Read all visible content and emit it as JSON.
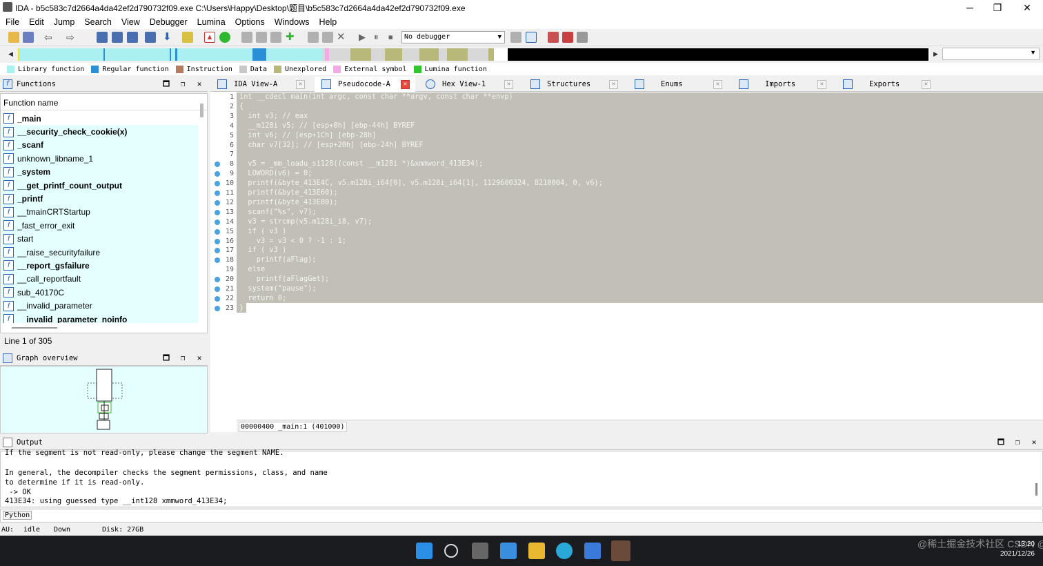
{
  "window": {
    "title": "IDA - b5c583c7d2664a4da42ef2d790732f09.exe C:\\Users\\Happy\\Desktop\\题目\\b5c583c7d2664a4da42ef2d790732f09.exe",
    "min": "─",
    "max": "❐",
    "close": "✕"
  },
  "menu": [
    "File",
    "Edit",
    "Jump",
    "Search",
    "View",
    "Debugger",
    "Lumina",
    "Options",
    "Windows",
    "Help"
  ],
  "toolbar": {
    "debugger": "No debugger"
  },
  "legend": [
    {
      "label": "Library function",
      "color": "#aaf0f0"
    },
    {
      "label": "Regular function",
      "color": "#2b8fd8"
    },
    {
      "label": "Instruction",
      "color": "#b87a5c"
    },
    {
      "label": "Data",
      "color": "#c8c8c8"
    },
    {
      "label": "Unexplored",
      "color": "#b8b878"
    },
    {
      "label": "External symbol",
      "color": "#f4a8e8"
    },
    {
      "label": "Lumina function",
      "color": "#2ec82e"
    }
  ],
  "functions_panel": {
    "title": "Functions",
    "column": "Function name",
    "items": [
      {
        "name": "_main",
        "bold": true
      },
      {
        "name": "__security_check_cookie(x)",
        "bold": true
      },
      {
        "name": "_scanf",
        "bold": true
      },
      {
        "name": "unknown_libname_1",
        "bold": false
      },
      {
        "name": "_system",
        "bold": true
      },
      {
        "name": "__get_printf_count_output",
        "bold": true
      },
      {
        "name": "_printf",
        "bold": true
      },
      {
        "name": "__tmainCRTStartup",
        "bold": false
      },
      {
        "name": "_fast_error_exit",
        "bold": false
      },
      {
        "name": "start",
        "bold": false
      },
      {
        "name": "__raise_securityfailure",
        "bold": false
      },
      {
        "name": "__report_gsfailure",
        "bold": true
      },
      {
        "name": "__call_reportfault",
        "bold": false
      },
      {
        "name": "sub_40170C",
        "bold": false
      },
      {
        "name": "__invalid_parameter",
        "bold": false
      },
      {
        "name": "__invalid_parameter_noinfo",
        "bold": true
      }
    ],
    "line_info": "Line 1 of 305"
  },
  "graph_panel": {
    "title": "Graph overview"
  },
  "tabs": [
    {
      "label": "IDA View-A",
      "active": false
    },
    {
      "label": "Pseudocode-A",
      "active": true
    },
    {
      "label": "Hex View-1",
      "active": false
    },
    {
      "label": "Structures",
      "active": false
    },
    {
      "label": "Enums",
      "active": false
    },
    {
      "label": "Imports",
      "active": false
    },
    {
      "label": "Exports",
      "active": false
    }
  ],
  "code": {
    "lines": [
      "int __cdecl main(int argc, const char **argv, const char **envp)",
      "{",
      "  int v3; // eax",
      "  __m128i v5; // [esp+0h] [ebp-44h] BYREF",
      "  int v6; // [esp+1Ch] [ebp-28h]",
      "  char v7[32]; // [esp+20h] [ebp-24h] BYREF",
      "",
      "  v5 = _mm_loadu_si128((const __m128i *)&xmmword_413E34);",
      "  LOWORD(v6) = 0;",
      "  printf(&byte_413E4C, v5.m128i_i64[0], v5.m128i_i64[1], 1129600324, 8210004, 0, v6);",
      "  printf(&byte_413E60);",
      "  printf(&byte_413E80);",
      "  scanf(\"%s\", v7);",
      "  v3 = strcmp(v5.m128i_i8, v7);",
      "  if ( v3 )",
      "    v3 = v3 < 0 ? -1 : 1;",
      "  if ( v3 )",
      "    printf(aFlag);",
      "  else",
      "    printf(aFlagGet);",
      "  system(\"pause\");",
      "  return 0;",
      "}"
    ],
    "line_numbers": [
      "1",
      "2",
      "3",
      "4",
      "5",
      "6",
      "7",
      "8",
      "9",
      "10",
      "11",
      "12",
      "13",
      "14",
      "15",
      "16",
      "17",
      "18",
      "19",
      "20",
      "21",
      "22",
      "23"
    ],
    "breakpoint_dots": [
      8,
      9,
      10,
      11,
      12,
      13,
      14,
      15,
      16,
      17,
      18,
      20,
      21,
      22,
      23
    ],
    "status": "00000400 _main:1 (401000)"
  },
  "output": {
    "title": "Output",
    "lines": [
      "If the segment is not read-only, please change the segment NAME.",
      "",
      "In general, the decompiler checks the segment permissions, class, and name",
      "to determine if it is read-only.",
      " -> OK",
      "413E34: using guessed type __int128 xmmword_413E34;"
    ],
    "python_label": "Python"
  },
  "statusbar": {
    "au": "AU:",
    "state": "idle",
    "dir": "Down",
    "disk": "Disk: 27GB"
  },
  "taskbar": {
    "time": "13:20",
    "date": "2021/12/26"
  },
  "watermark": "@稀土掘金技术社区  CSDN @鬼公子鸭"
}
